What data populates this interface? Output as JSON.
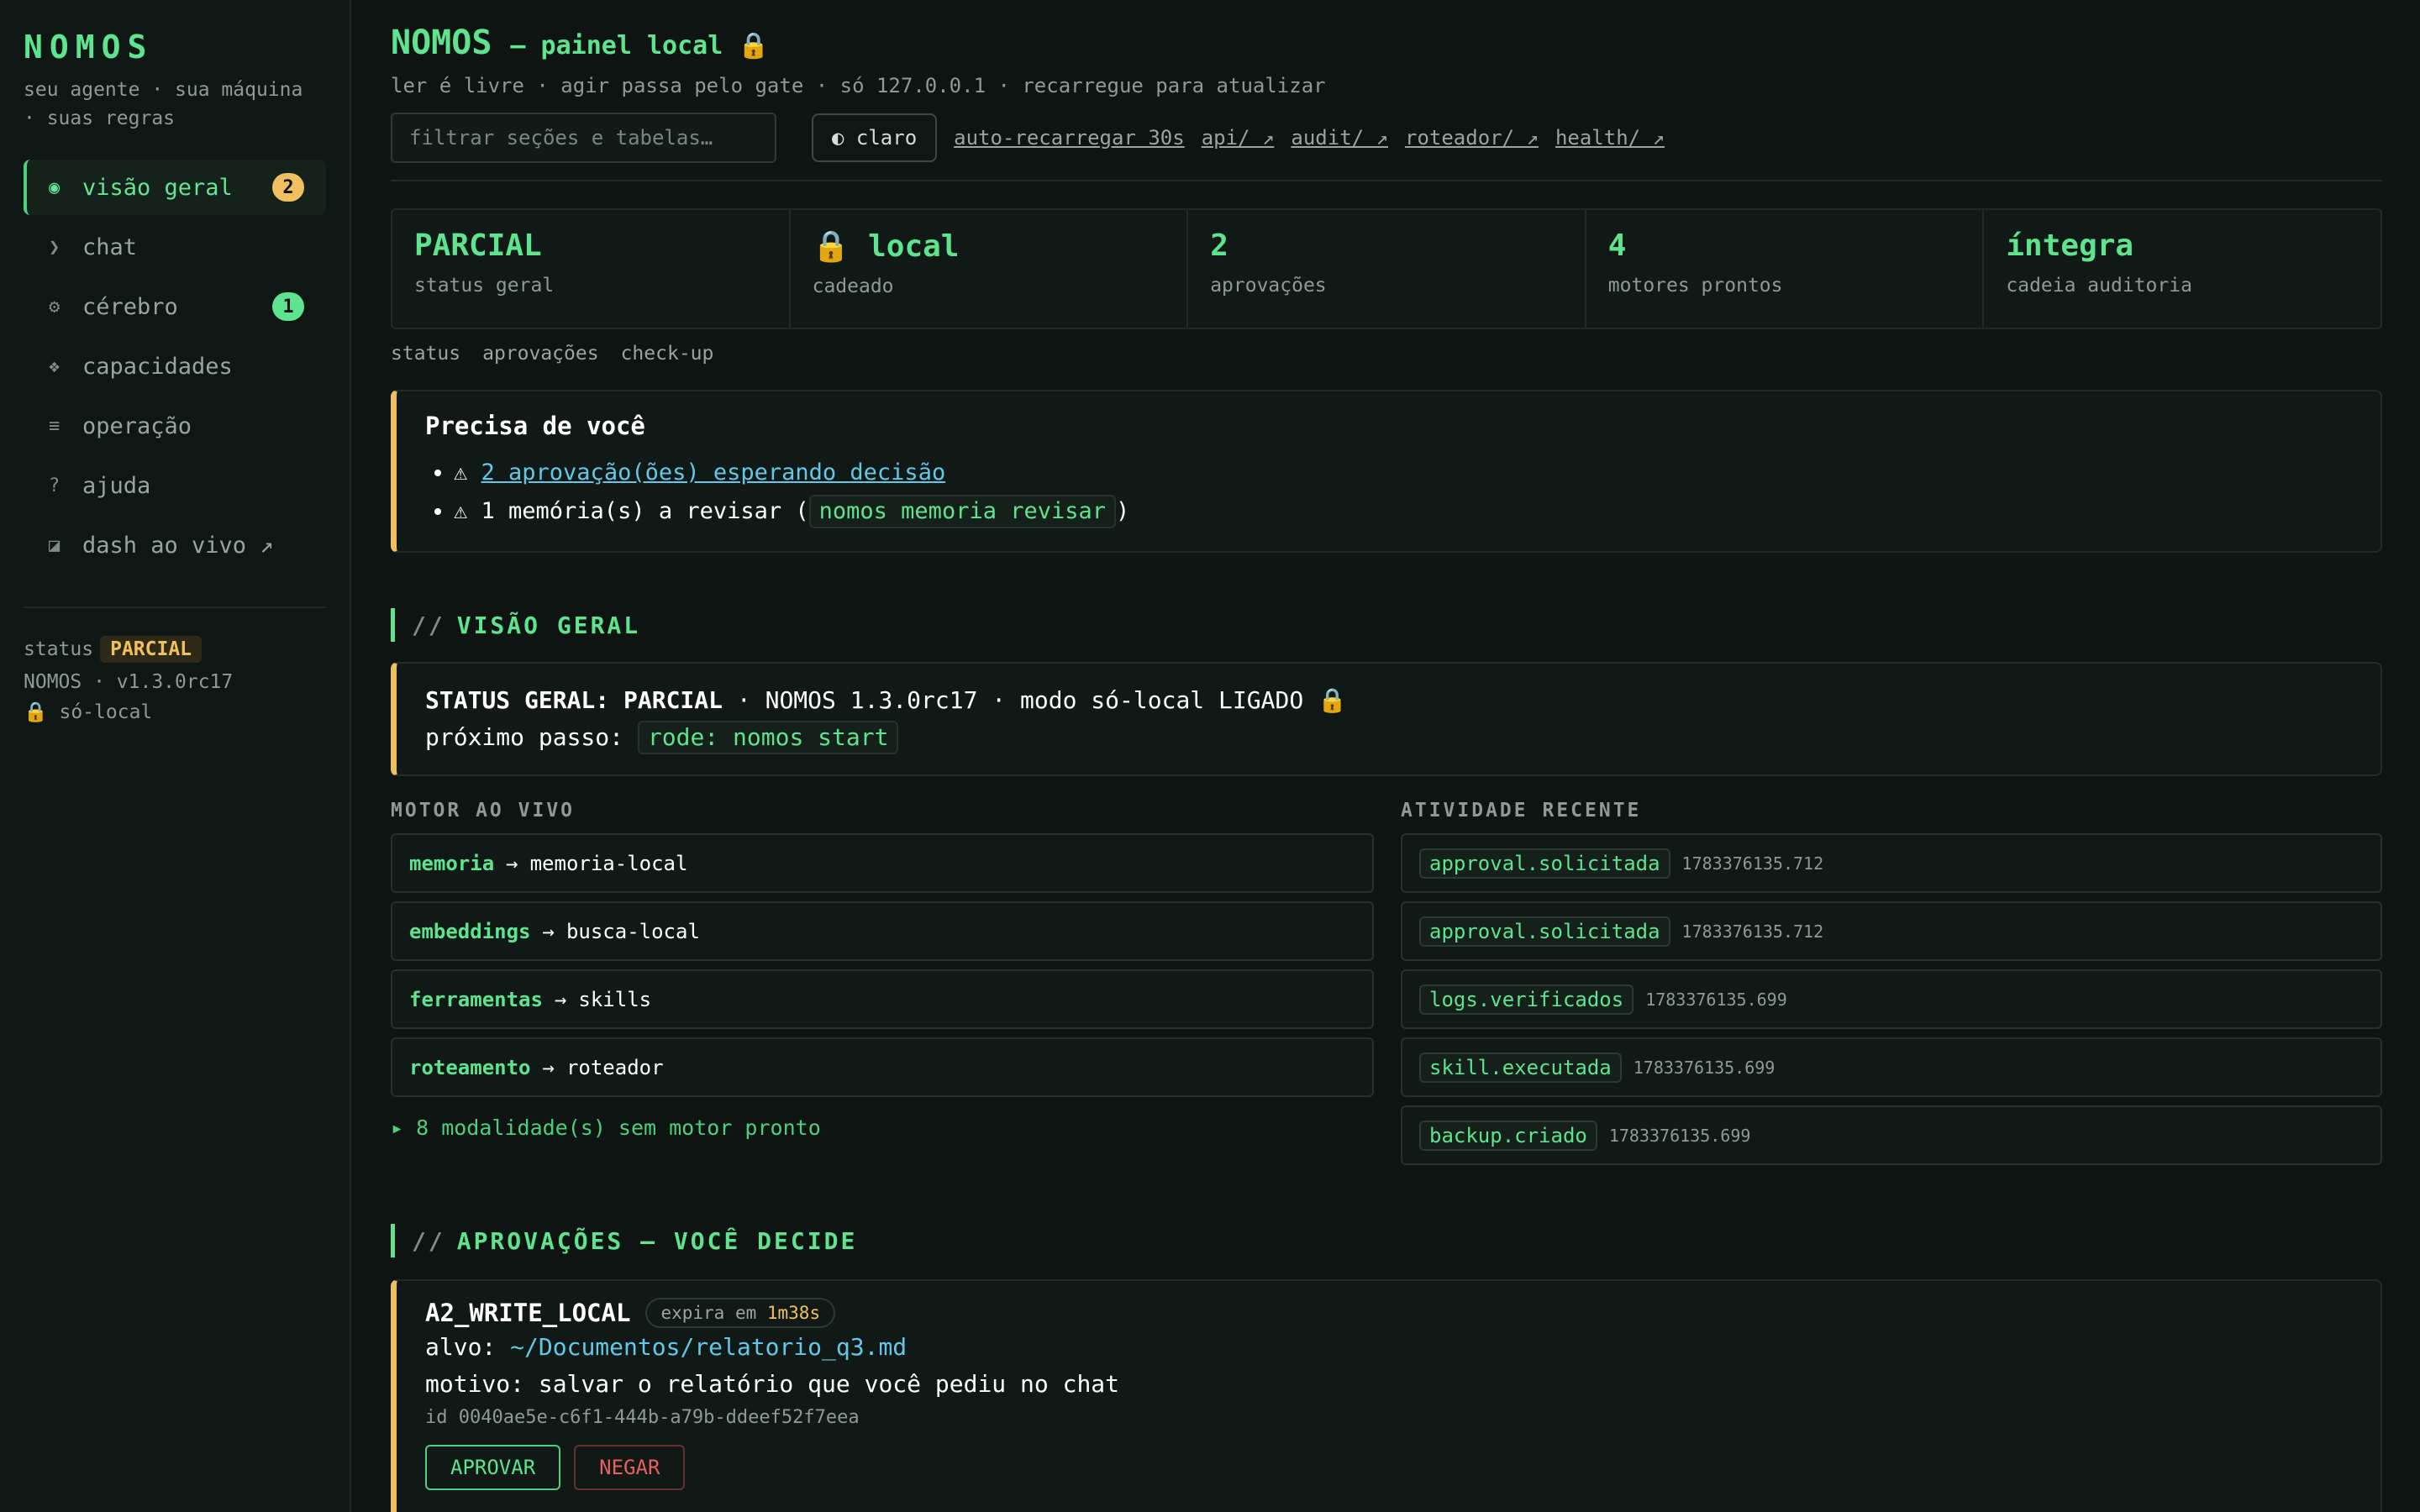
{
  "sidebar": {
    "brand": "NOMOS",
    "tagline": "seu agente · sua máquina · suas regras",
    "items": [
      {
        "icon": "◉",
        "label": "visão geral",
        "badge": "2"
      },
      {
        "icon": "❯",
        "label": "chat"
      },
      {
        "icon": "⚙",
        "label": "cérebro",
        "badge": "1"
      },
      {
        "icon": "❖",
        "label": "capacidades"
      },
      {
        "icon": "≡",
        "label": "operação"
      },
      {
        "icon": "?",
        "label": "ajuda"
      },
      {
        "icon": "◪",
        "label": "dash ao vivo ↗"
      }
    ],
    "status_label": "status",
    "status_value": "PARCIAL",
    "version": "NOMOS · v1.3.0rc17",
    "local_mode": "🔒 só-local"
  },
  "header": {
    "title": "NOMOS",
    "subtitle": "— painel local 🔒",
    "description": "ler é livre · agir passa pelo gate · só 127.0.0.1 · recarregue para atualizar",
    "filter_placeholder": "filtrar seções e tabelas…",
    "theme_button": "◐ claro",
    "links": [
      "auto-recarregar 30s",
      "api/ ↗",
      "audit/ ↗",
      "roteador/ ↗",
      "health/ ↗"
    ]
  },
  "stats": [
    {
      "value": "PARCIAL",
      "label": "status geral"
    },
    {
      "value": "🔒 local",
      "label": "cadeado"
    },
    {
      "value": "2",
      "label": "aprovações"
    },
    {
      "value": "4",
      "label": "motores prontos"
    },
    {
      "value": "íntegra",
      "label": "cadeia auditoria"
    }
  ],
  "anchors": [
    "status",
    "aprovações",
    "check-up"
  ],
  "needs_you": {
    "title": "Precisa de você",
    "item1_prefix": "⚠ ",
    "item1_link": "2 aprovação(ões) esperando decisão",
    "item2_prefix": "⚠ 1 memória(s) a revisar (",
    "item2_code": "nomos memoria revisar",
    "item2_suffix": ")"
  },
  "overview": {
    "heading": "VISÃO GERAL",
    "status_bold": "STATUS GERAL: PARCIAL",
    "status_rest": " · NOMOS 1.3.0rc17 · modo só-local LIGADO 🔒",
    "next_label": "próximo passo: ",
    "next_code": "rode: nomos start"
  },
  "engines": {
    "heading": "MOTOR AO VIVO",
    "rows": [
      {
        "name": "memoria",
        "target": "memoria-local"
      },
      {
        "name": "embeddings",
        "target": "busca-local"
      },
      {
        "name": "ferramentas",
        "target": "skills"
      },
      {
        "name": "roteamento",
        "target": "roteador"
      }
    ],
    "more": "▸ 8 modalidade(s) sem motor pronto"
  },
  "activity": {
    "heading": "ATIVIDADE RECENTE",
    "rows": [
      {
        "event": "approval.solicitada",
        "ts": "1783376135.712"
      },
      {
        "event": "approval.solicitada",
        "ts": "1783376135.712"
      },
      {
        "event": "logs.verificados",
        "ts": "1783376135.699"
      },
      {
        "event": "skill.executada",
        "ts": "1783376135.699"
      },
      {
        "event": "backup.criado",
        "ts": "1783376135.699"
      }
    ]
  },
  "approvals": {
    "heading": "APROVAÇÕES — VOCÊ DECIDE",
    "card": {
      "action": "A2_WRITE_LOCAL",
      "expires_label": "expira em ",
      "expires_value": "1m38s",
      "target_label": "alvo: ",
      "target_value": "~/Documentos/relatorio_q3.md",
      "reason": "motivo: salvar o relatório que você pediu no chat",
      "id": "id 0040ae5e-c6f1-444b-a79b-ddeef52f7eea",
      "approve": "APROVAR",
      "deny": "NEGAR"
    }
  },
  "colors": {
    "accent": "#5ee38f",
    "warn": "#f0c060",
    "link": "#63c7e8",
    "danger": "#e85f5f",
    "background": "#0d1411"
  }
}
